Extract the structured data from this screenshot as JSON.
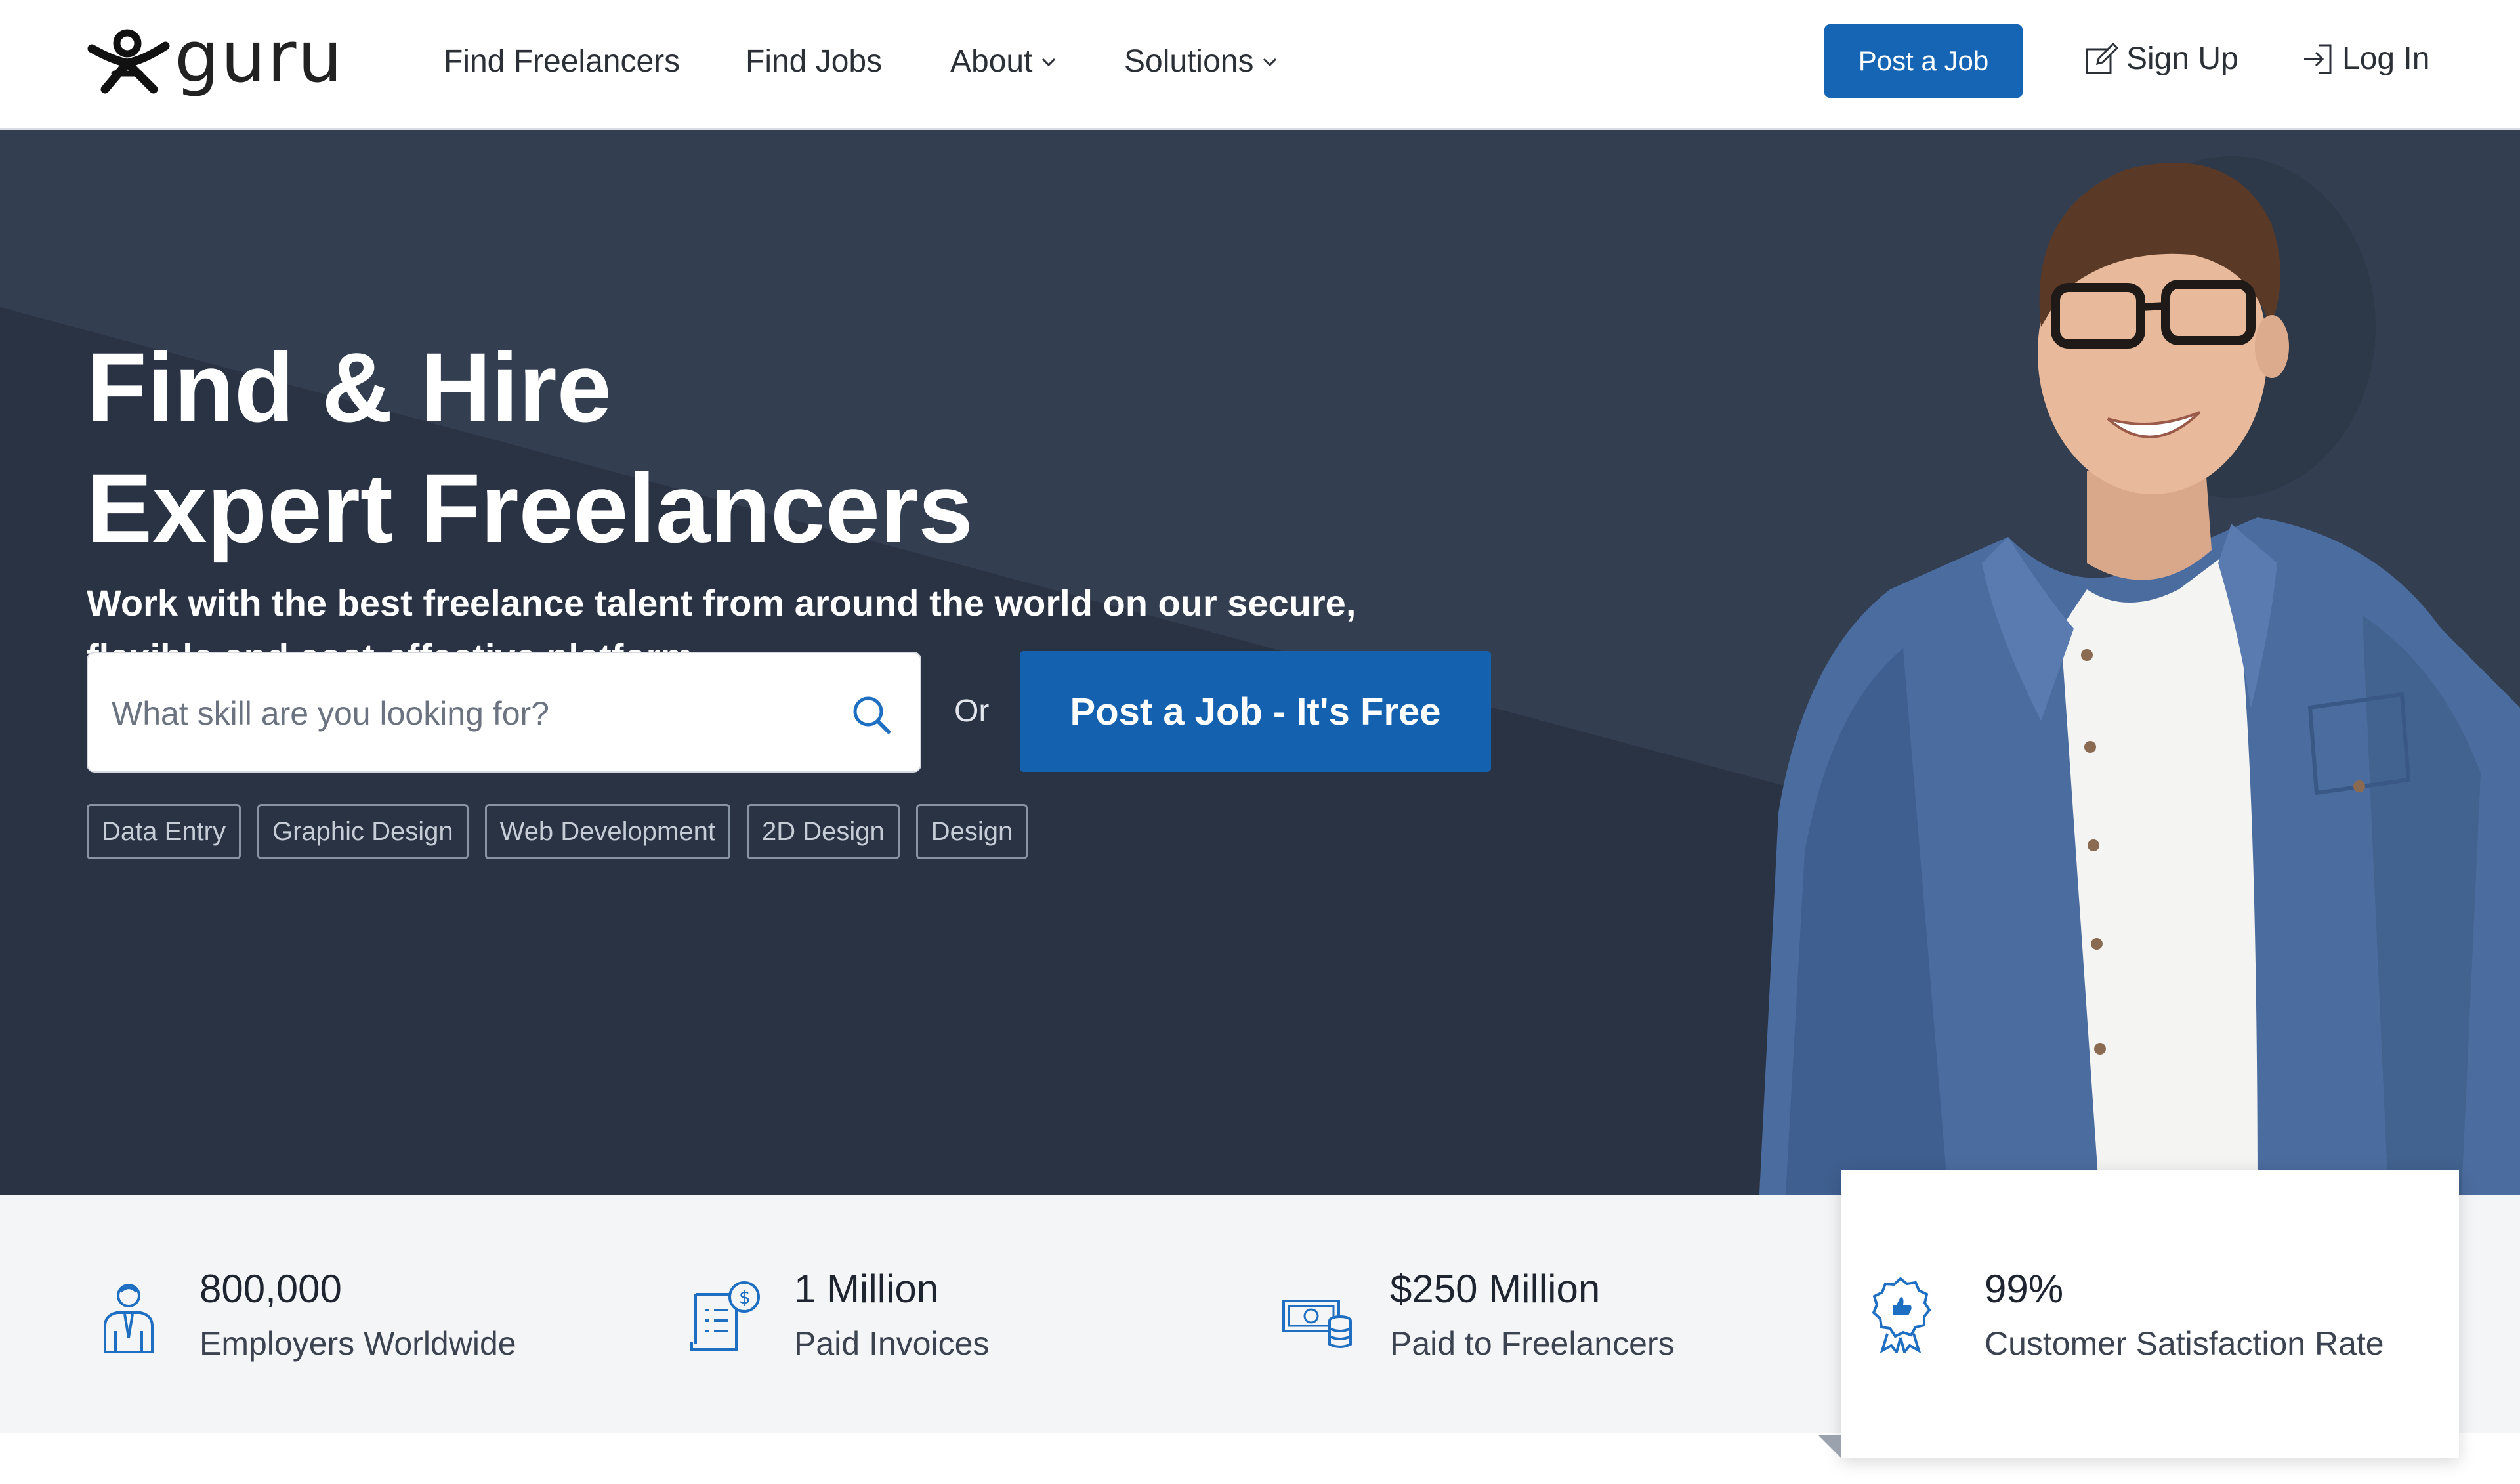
{
  "nav": {
    "logo_text": "guru",
    "links": [
      {
        "label": "Find Freelancers"
      },
      {
        "label": "Find Jobs"
      },
      {
        "label": "About"
      },
      {
        "label": "Solutions"
      }
    ],
    "post_job_label": "Post a Job",
    "sign_up_label": "Sign Up",
    "log_in_label": "Log In"
  },
  "hero": {
    "title_line1": "Find & Hire",
    "title_line2": "Expert Freelancers",
    "subtitle_line1": "Work with the best freelance talent from around the world on our secure,",
    "subtitle_line2": "flexible and cost-effective platform.",
    "search_placeholder": "What skill are you looking for?",
    "or_label": "Or",
    "post_job_cta": "Post a Job - It's Free",
    "tags": [
      "Data Entry",
      "Graphic Design",
      "Web Development",
      "2D Design",
      "Design"
    ]
  },
  "stats": [
    {
      "value": "800,000",
      "label": "Employers Worldwide",
      "icon": "employer-icon"
    },
    {
      "value": "1 Million",
      "label": "Paid Invoices",
      "icon": "invoice-icon"
    },
    {
      "value": "$250 Million",
      "label": "Paid to Freelancers",
      "icon": "money-icon"
    },
    {
      "value": "99%",
      "label": "Customer Satisfaction Rate",
      "icon": "award-icon"
    }
  ],
  "colors": {
    "brand_blue": "#1565b4",
    "hero_bg": "#2e3849",
    "stats_bg": "#f4f5f7",
    "icon_blue": "#1e6fc2"
  }
}
